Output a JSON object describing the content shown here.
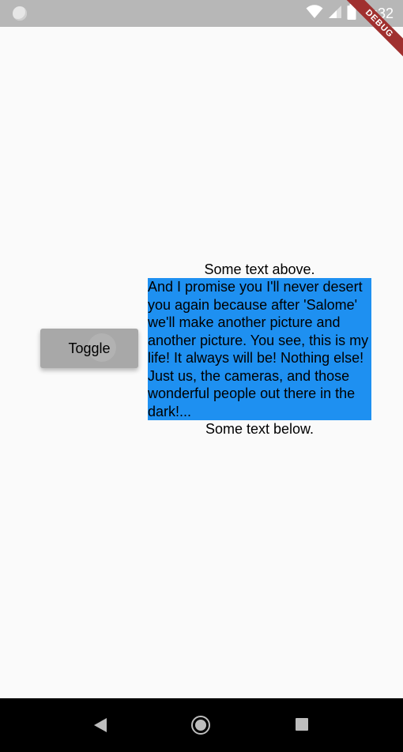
{
  "status_bar": {
    "time": "1:32",
    "icons": [
      "circle-notification-icon",
      "wifi-icon",
      "cell-signal-icon",
      "battery-icon"
    ]
  },
  "debug_banner": {
    "label": "DEBUG"
  },
  "main": {
    "toggle_button_label": "Toggle",
    "text_above": "Some text above.",
    "highlighted_text": "And I promise you I'll never desert you again because after 'Salome' we'll make another picture and another picture. You see, this is my life! It always will be! Nothing else! Just us, the cameras, and those wonderful people out there in the dark!...",
    "text_below": "Some text below.",
    "highlight_color": "#1e90f1"
  },
  "nav_bar": {
    "icons": [
      "back-icon",
      "home-icon",
      "recents-icon"
    ]
  }
}
